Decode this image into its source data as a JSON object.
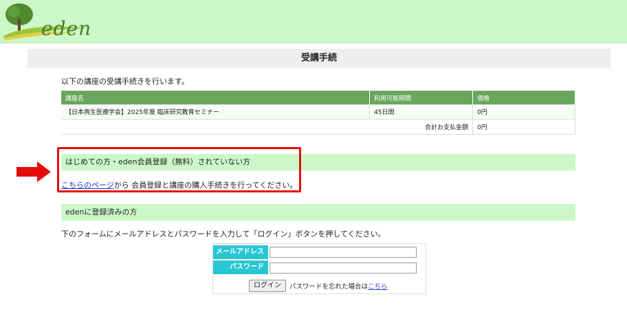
{
  "header": {
    "logo_text": "eden",
    "bg": "#ccf7c9"
  },
  "page_title": "受講手続",
  "intro": "以下の講座の受講手続きを行います。",
  "course_table": {
    "headers": [
      "講座名",
      "利用可能期間",
      "価格"
    ],
    "rows": [
      [
        "【日本再生医療学会】2025年度 臨床研究教育セミナー",
        "45日間",
        "0円"
      ]
    ],
    "total_label": "合計お支払金額",
    "total_value": "0円"
  },
  "new_user": {
    "heading": "はじめての方・eden会員登録（無料）されていない方",
    "link_text": "こちらのページ",
    "text_after": "から 会員登録と講座の購入手続きを行ってください。"
  },
  "registered": {
    "heading": "edenに登録済みの方",
    "instruction": "下のフォームにメールアドレスとパスワードを入力して「ログイン」ボタンを押してください。"
  },
  "login": {
    "email_label": "メールアドレス",
    "password_label": "パスワード",
    "email_value": "",
    "password_value": "",
    "button_label": "ログイン",
    "forgot_text": "パスワードを忘れた場合は",
    "forgot_link": "こちら"
  },
  "colors": {
    "accent_green": "#6aa65c",
    "highlight_red": "#e50b0b",
    "label_cyan": "#27c6d2"
  },
  "icons": {
    "logo": "tree-icon",
    "arrow": "right-arrow-icon"
  }
}
